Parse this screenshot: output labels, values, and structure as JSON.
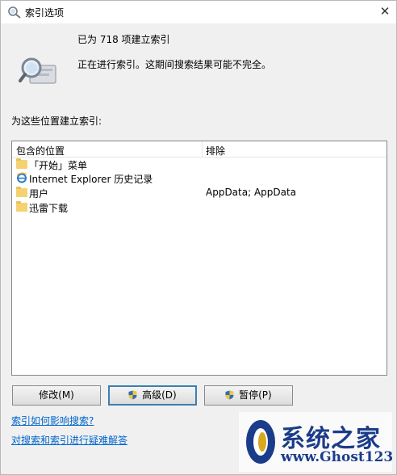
{
  "window": {
    "title": "索引选项",
    "close_glyph": "✕"
  },
  "status": {
    "indexed_text": "已为 718 项建立索引",
    "progress_text": "正在进行索引。这期间搜索结果可能不完全。"
  },
  "locations": {
    "section_label": "为这些位置建立索引:",
    "col_included": "包含的位置",
    "col_excluded": "排除",
    "rows": [
      {
        "icon": "folder-icon",
        "label": "「开始」菜单",
        "exclude": ""
      },
      {
        "icon": "ie-icon",
        "label": "Internet Explorer 历史记录",
        "exclude": ""
      },
      {
        "icon": "folder-icon",
        "label": "用户",
        "exclude": "AppData; AppData"
      },
      {
        "icon": "folder-icon",
        "label": "迅雷下载",
        "exclude": ""
      }
    ]
  },
  "buttons": {
    "modify": "修改(M)",
    "advanced": "高级(D)",
    "pause": "暂停(P)"
  },
  "links": {
    "how_index_affects": "索引如何影响搜索?",
    "troubleshoot": "对搜索和索引进行疑难解答"
  },
  "watermark": {
    "line1": "系统之家",
    "line2": "www.Ghost123.com"
  },
  "colors": {
    "accent_blue": "#3c7fb1",
    "link": "#0066cc",
    "folder": "#f5d271",
    "watermark": "#1b3c8a"
  }
}
